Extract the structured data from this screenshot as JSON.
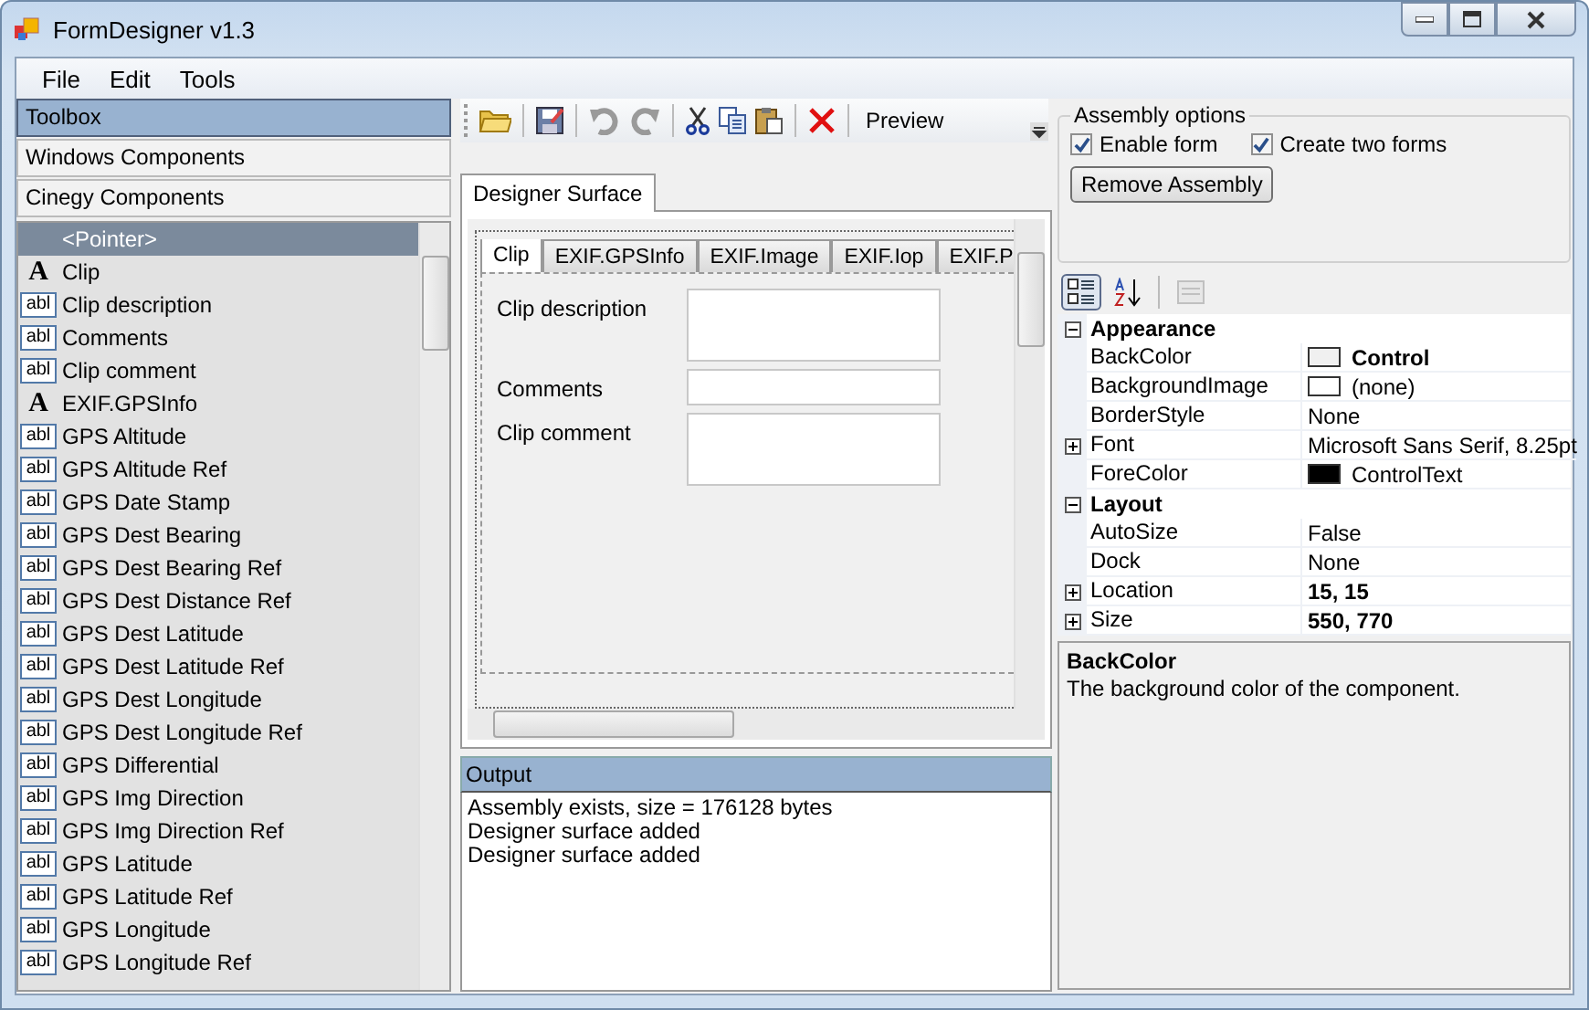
{
  "window": {
    "title": "FormDesigner v1.3"
  },
  "menu": [
    "File",
    "Edit",
    "Tools"
  ],
  "toolbox": {
    "sections": [
      {
        "label": "Toolbox",
        "selected": true
      },
      {
        "label": "Windows Components",
        "selected": false
      },
      {
        "label": "Cinegy Components",
        "selected": false
      }
    ],
    "items": [
      {
        "label": "<Pointer>",
        "kind": "pointer",
        "selected": true
      },
      {
        "label": "Clip",
        "kind": "label",
        "icon": "A",
        "selected": false
      },
      {
        "label": "Clip description",
        "kind": "textbox",
        "icon": "abl",
        "selected": false
      },
      {
        "label": "Comments",
        "kind": "textbox",
        "icon": "abl",
        "selected": false
      },
      {
        "label": "Clip comment",
        "kind": "textbox",
        "icon": "abl",
        "selected": false
      },
      {
        "label": "EXIF.GPSInfo",
        "kind": "label",
        "icon": "A",
        "selected": false
      },
      {
        "label": "GPS Altitude",
        "kind": "textbox",
        "icon": "abl",
        "selected": false
      },
      {
        "label": "GPS Altitude Ref",
        "kind": "textbox",
        "icon": "abl",
        "selected": false
      },
      {
        "label": "GPS Date Stamp",
        "kind": "textbox",
        "icon": "abl",
        "selected": false
      },
      {
        "label": "GPS Dest Bearing",
        "kind": "textbox",
        "icon": "abl",
        "selected": false
      },
      {
        "label": "GPS Dest Bearing Ref",
        "kind": "textbox",
        "icon": "abl",
        "selected": false
      },
      {
        "label": "GPS Dest Distance Ref",
        "kind": "textbox",
        "icon": "abl",
        "selected": false
      },
      {
        "label": "GPS Dest Latitude",
        "kind": "textbox",
        "icon": "abl",
        "selected": false
      },
      {
        "label": "GPS Dest Latitude Ref",
        "kind": "textbox",
        "icon": "abl",
        "selected": false
      },
      {
        "label": "GPS Dest Longitude",
        "kind": "textbox",
        "icon": "abl",
        "selected": false
      },
      {
        "label": "GPS Dest Longitude Ref",
        "kind": "textbox",
        "icon": "abl",
        "selected": false
      },
      {
        "label": "GPS Differential",
        "kind": "textbox",
        "icon": "abl",
        "selected": false
      },
      {
        "label": "GPS Img Direction",
        "kind": "textbox",
        "icon": "abl",
        "selected": false
      },
      {
        "label": "GPS Img Direction Ref",
        "kind": "textbox",
        "icon": "abl",
        "selected": false
      },
      {
        "label": "GPS Latitude",
        "kind": "textbox",
        "icon": "abl",
        "selected": false
      },
      {
        "label": "GPS Latitude Ref",
        "kind": "textbox",
        "icon": "abl",
        "selected": false
      },
      {
        "label": "GPS Longitude",
        "kind": "textbox",
        "icon": "abl",
        "selected": false
      },
      {
        "label": "GPS Longitude Ref",
        "kind": "textbox",
        "icon": "abl",
        "selected": false
      }
    ]
  },
  "toolbar": {
    "preview": "Preview"
  },
  "designer": {
    "tab": "Designer Surface",
    "form_tabs": [
      {
        "label": "Clip",
        "selected": true
      },
      {
        "label": "EXIF.GPSInfo",
        "selected": false
      },
      {
        "label": "EXIF.Image",
        "selected": false
      },
      {
        "label": "EXIF.Iop",
        "selected": false
      },
      {
        "label": "EXIF.P",
        "selected": false
      }
    ],
    "fields": [
      {
        "label": "Clip description",
        "kind": "multiline"
      },
      {
        "label": "Comments",
        "kind": "single"
      },
      {
        "label": "Clip comment",
        "kind": "multiline"
      }
    ]
  },
  "output": {
    "title": "Output",
    "lines": [
      "Assembly exists, size = 176128 bytes",
      "Designer surface added",
      "Designer surface added"
    ]
  },
  "assembly": {
    "title": "Assembly options",
    "checkboxes": [
      {
        "label": "Enable form",
        "checked": true
      },
      {
        "label": "Create two forms",
        "checked": true
      }
    ],
    "button": "Remove Assembly"
  },
  "properties": {
    "view_buttons": [
      {
        "kind": "categorized",
        "selected": true,
        "disabled": false
      },
      {
        "kind": "alphabetical",
        "selected": false,
        "disabled": false
      },
      {
        "kind": "pages",
        "selected": false,
        "disabled": true
      }
    ],
    "groups": [
      {
        "name": "Appearance",
        "expanded": true,
        "rows": [
          {
            "name": "BackColor",
            "value": "Control",
            "color": "#f0f0f0",
            "modified": true,
            "expandable": false
          },
          {
            "name": "BackgroundImage",
            "value": "(none)",
            "color": "#ffffff",
            "modified": false,
            "expandable": false
          },
          {
            "name": "BorderStyle",
            "value": "None",
            "modified": false,
            "expandable": false
          },
          {
            "name": "Font",
            "value": "Microsoft Sans Serif, 8.25pt",
            "modified": false,
            "expandable": true
          },
          {
            "name": "ForeColor",
            "value": "ControlText",
            "color": "#000000",
            "modified": false,
            "expandable": false
          }
        ]
      },
      {
        "name": "Layout",
        "expanded": true,
        "rows": [
          {
            "name": "AutoSize",
            "value": "False",
            "modified": false,
            "expandable": false
          },
          {
            "name": "Dock",
            "value": "None",
            "modified": false,
            "expandable": false
          },
          {
            "name": "Location",
            "value": "15, 15",
            "modified": true,
            "expandable": true
          },
          {
            "name": "Size",
            "value": "550, 770",
            "modified": true,
            "expandable": true
          }
        ]
      }
    ]
  },
  "description": {
    "title": "BackColor",
    "text": "The background color of the component."
  }
}
